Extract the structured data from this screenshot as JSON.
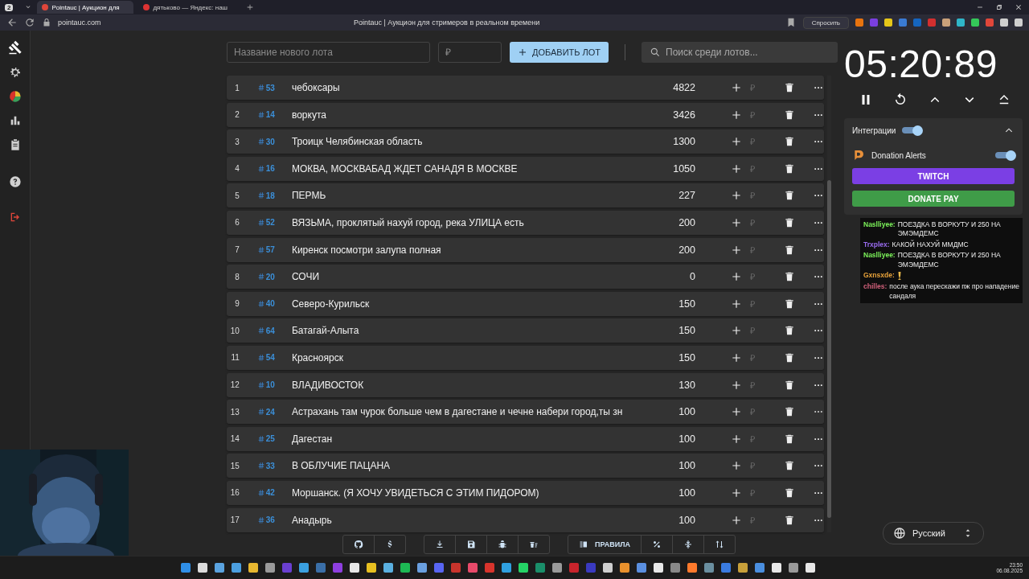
{
  "browser": {
    "tab_count": "2",
    "tabs": [
      {
        "title": "Pointauc | Аукцион для",
        "selected": true
      },
      {
        "title": "дятьково — Яндекс: наш",
        "selected": false
      }
    ],
    "url": "pointauc.com",
    "page_title": "Pointauc | Аукцион для стримеров в реальном времени",
    "ask_button": "Спросить"
  },
  "sidebar": {
    "items": [
      {
        "kind": "gavel",
        "selected": true
      },
      {
        "kind": "gear",
        "selected": false
      },
      {
        "kind": "pie",
        "selected": false
      },
      {
        "kind": "bars",
        "selected": false
      },
      {
        "kind": "clipboard",
        "selected": false
      },
      {
        "kind": "help",
        "selected": false
      },
      {
        "kind": "logout",
        "selected": false
      }
    ]
  },
  "new_lot": {
    "name_placeholder": "Название нового лота",
    "amount_placeholder": "₽",
    "add_button": "ДОБАВИТЬ ЛОТ"
  },
  "search": {
    "placeholder": "Поиск среди лотов..."
  },
  "lots": [
    {
      "rank": "1",
      "id": "53",
      "name": "чебоксары",
      "amount": "4822",
      "input_placeholder": "₽"
    },
    {
      "rank": "2",
      "id": "14",
      "name": "воркута",
      "amount": "3426",
      "input_placeholder": "₽"
    },
    {
      "rank": "3",
      "id": "30",
      "name": "Троицк Челябинская область",
      "amount": "1300",
      "input_placeholder": "₽"
    },
    {
      "rank": "4",
      "id": "16",
      "name": "МОКВА, МОСКВАБАД ЖДЕТ САНАДЯ В МОСКВЕ",
      "amount": "1050",
      "input_placeholder": "₽"
    },
    {
      "rank": "5",
      "id": "18",
      "name": "ПЕРМЬ",
      "amount": "227",
      "input_placeholder": "₽"
    },
    {
      "rank": "6",
      "id": "52",
      "name": "ВЯЗЬМА, проклятый нахуй город, река УЛИЦА есть",
      "amount": "200",
      "input_placeholder": "₽"
    },
    {
      "rank": "7",
      "id": "57",
      "name": "Киренск посмотри залупа полная",
      "amount": "200",
      "input_placeholder": "₽"
    },
    {
      "rank": "8",
      "id": "20",
      "name": "СОЧИ",
      "amount": "0",
      "input_placeholder": "₽"
    },
    {
      "rank": "9",
      "id": "40",
      "name": "Северо-Курильск",
      "amount": "150",
      "input_placeholder": "₽"
    },
    {
      "rank": "10",
      "id": "64",
      "name": "Батагай-Алыта",
      "amount": "150",
      "input_placeholder": "₽"
    },
    {
      "rank": "11",
      "id": "54",
      "name": "Красноярск",
      "amount": "150",
      "input_placeholder": "₽"
    },
    {
      "rank": "12",
      "id": "10",
      "name": "ВЛАДИВОСТОК",
      "amount": "130",
      "input_placeholder": "₽"
    },
    {
      "rank": "13",
      "id": "24",
      "name": "Астрахань там чурок больше чем в дагестане и чечне набери город,ты зн",
      "amount": "100",
      "input_placeholder": "₽"
    },
    {
      "rank": "14",
      "id": "25",
      "name": "Дагестан",
      "amount": "100",
      "input_placeholder": "₽"
    },
    {
      "rank": "15",
      "id": "33",
      "name": "В ОБЛУЧИЕ ПАЦАНА",
      "amount": "100",
      "input_placeholder": "₽"
    },
    {
      "rank": "16",
      "id": "42",
      "name": "Моршанск. (Я ХОЧУ УВИДЕТЬСЯ С ЭТИМ ПИДОРОМ)",
      "amount": "100",
      "input_placeholder": "₽"
    },
    {
      "rank": "17",
      "id": "36",
      "name": "Анадырь",
      "amount": "100",
      "input_placeholder": "₽"
    }
  ],
  "timer": {
    "time": "05:20:89"
  },
  "integrations": {
    "label": "Интеграции",
    "on": true,
    "expanded": true,
    "services": [
      {
        "kind": "toggle",
        "name": "Donation Alerts",
        "on": true
      },
      {
        "kind": "button",
        "name": "TWITCH",
        "color": "#7b3fe4"
      },
      {
        "kind": "button",
        "name": "DONATE PAY",
        "color": "#3f9c48"
      }
    ]
  },
  "chat": [
    {
      "kind": "text",
      "user": "Naslliyee:",
      "text": "ПОЕЗДКА В ВОРКУТУ И 250 НА ЭМЭМДЕМС",
      "color": "#7cf25a"
    },
    {
      "kind": "text",
      "user": "Trxplex:",
      "text": "КАКОЙ НАХУЙ ММДМС",
      "color": "#9a6cf0"
    },
    {
      "kind": "text",
      "user": "Naslliyee:",
      "text": "ПОЕЗДКА В ВОРКУТУ И 250 НА ЭМЭМДЕМС",
      "color": "#7cf25a"
    },
    {
      "kind": "emote",
      "user": "Gxnsxde:",
      "color": "#e8a23a"
    },
    {
      "kind": "text",
      "user": "chilles:",
      "text": "после аука перескажи пж про нападение сандаля",
      "color": "#d0607a"
    }
  ],
  "toolbar": {
    "groups": [
      [
        {
          "kind": "github"
        },
        {
          "kind": "dollar"
        }
      ],
      [
        {
          "kind": "download"
        },
        {
          "kind": "save"
        },
        {
          "kind": "bug"
        },
        {
          "kind": "clear"
        }
      ],
      [
        {
          "kind": "rules",
          "label": "ПРАВИЛА"
        },
        {
          "kind": "percent"
        },
        {
          "kind": "compress"
        },
        {
          "kind": "sort"
        }
      ]
    ]
  },
  "language": {
    "value": "Русский"
  },
  "taskbar": {
    "time": "23:50",
    "date": "06.08.2025"
  }
}
